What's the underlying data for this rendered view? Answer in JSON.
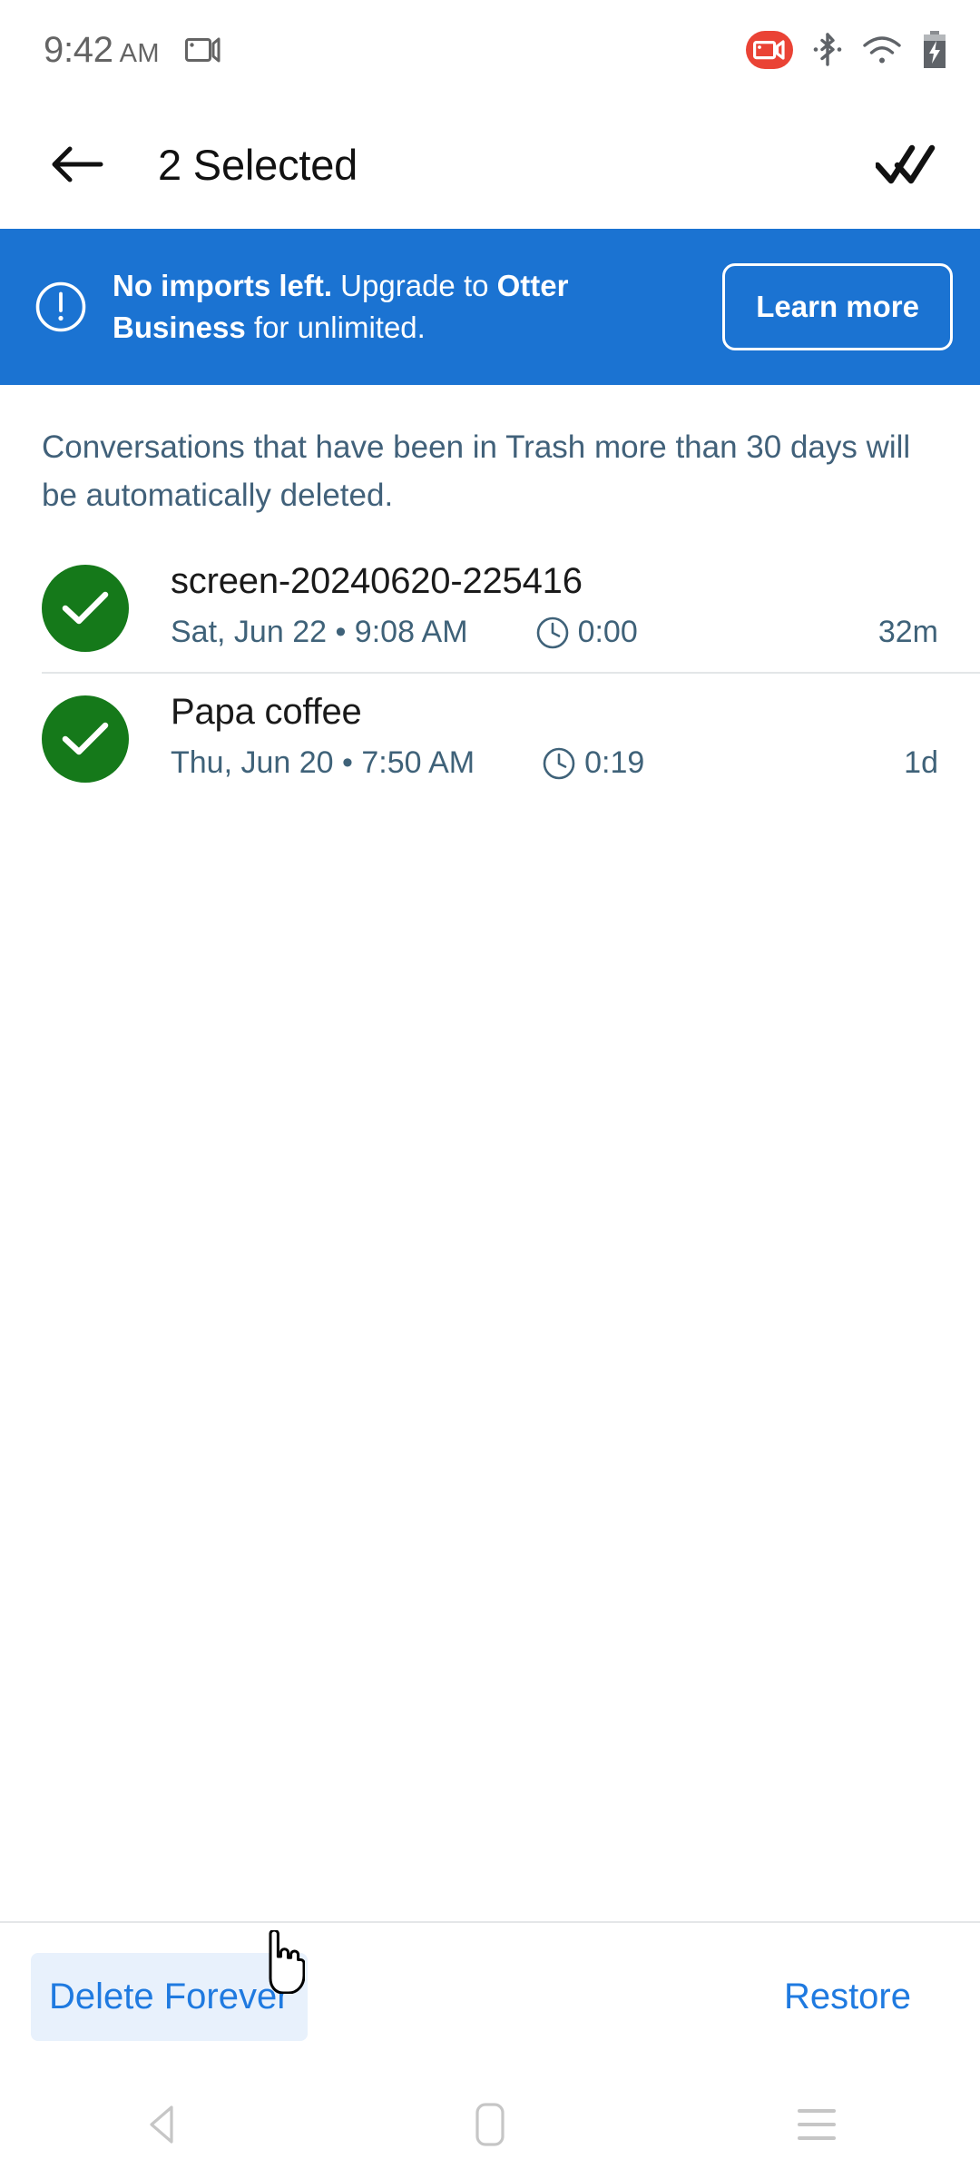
{
  "status_bar": {
    "time": "9:42",
    "ampm": "AM",
    "cast_icon": "screencast-icon",
    "recording_icon": "screen-recording-icon",
    "bluetooth_icon": "bluetooth-icon",
    "wifi_icon": "wifi-icon",
    "battery_icon": "battery-charging-icon",
    "recording_color": "#ea4335",
    "text_color": "#646464"
  },
  "app_bar": {
    "back_icon": "back-arrow-icon",
    "title": "2 Selected",
    "action_icon": "select-all-double-check-icon"
  },
  "banner": {
    "icon": "alert-circle-icon",
    "text_bold_1": "No imports left.",
    "text_normal_1": " Upgrade to ",
    "text_bold_2": "Otter Business",
    "text_normal_2": " for unlimited.",
    "button_label": "Learn more",
    "background_color": "#1b73d2",
    "text_color": "#ffffff"
  },
  "main": {
    "trash_note": "Conversations that have been in Trash more than 30 days will be automatically deleted.",
    "note_color": "#41617a",
    "checked_color": "#15791a",
    "conversations": [
      {
        "title": "screen-20240620-225416",
        "date": "Sat, Jun 22 • 9:08 AM",
        "duration_icon": "clock-icon",
        "duration": "0:00",
        "age": "32m",
        "selected": true
      },
      {
        "title": "Papa coffee",
        "date": "Thu, Jun 20 • 7:50 AM",
        "duration_icon": "clock-icon",
        "duration": "0:19",
        "age": "1d",
        "selected": true
      }
    ]
  },
  "action_bar": {
    "delete_label": "Delete Forever",
    "restore_label": "Restore",
    "accent_color": "#1f7ae0",
    "hover_background": "#e8f1fc",
    "cursor": "pointer-hand-cursor"
  },
  "nav_bar": {
    "back_icon": "nav-back-triangle-icon",
    "home_icon": "nav-home-icon",
    "recents_icon": "nav-recents-icon",
    "icon_color": "#c6c6c6"
  }
}
